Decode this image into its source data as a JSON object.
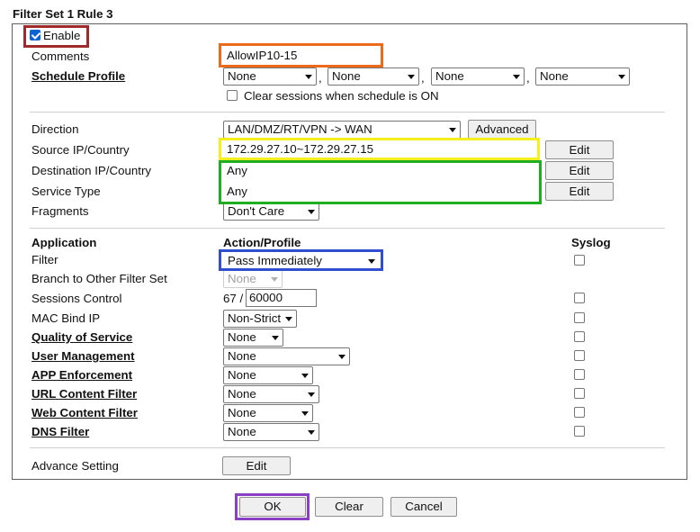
{
  "page_title": "Filter Set 1 Rule 3",
  "enable": {
    "label": "Enable",
    "checked": true
  },
  "comments": {
    "label": "Comments",
    "value": "AllowIP10-15"
  },
  "schedule": {
    "label": "Schedule Profile",
    "profiles": [
      "None",
      "None",
      "None",
      "None"
    ],
    "separator": ",",
    "clear_sessions_label": "Clear sessions when schedule is ON"
  },
  "direction": {
    "label": "Direction",
    "value": "LAN/DMZ/RT/VPN -> WAN",
    "advanced_label": "Advanced"
  },
  "source": {
    "label": "Source IP/Country",
    "value": "172.29.27.10~172.29.27.15",
    "edit_label": "Edit"
  },
  "destination": {
    "label": "Destination IP/Country",
    "value": "Any",
    "edit_label": "Edit"
  },
  "service": {
    "label": "Service Type",
    "value": "Any",
    "edit_label": "Edit"
  },
  "fragments": {
    "label": "Fragments",
    "value": "Don't Care"
  },
  "headers": {
    "application": "Application",
    "action": "Action/Profile",
    "syslog": "Syslog"
  },
  "filter": {
    "label": "Filter",
    "value": "Pass Immediately"
  },
  "branch": {
    "label": "Branch to Other Filter Set",
    "value": "None"
  },
  "sessions": {
    "label": "Sessions Control",
    "current": "67 /",
    "max": "60000"
  },
  "mac_bind": {
    "label": "MAC Bind IP",
    "value": "Non-Strict"
  },
  "qos": {
    "label": "Quality of Service",
    "value": "None"
  },
  "user_mgmt": {
    "label": "User Management",
    "value": "None"
  },
  "app_enf": {
    "label": "APP Enforcement",
    "value": "None"
  },
  "url_filter": {
    "label": "URL Content Filter",
    "value": "None"
  },
  "web_filter": {
    "label": "Web Content Filter",
    "value": "None"
  },
  "dns_filter": {
    "label": "DNS Filter",
    "value": "None"
  },
  "advance": {
    "label": "Advance Setting",
    "edit_label": "Edit"
  },
  "footer": {
    "ok": "OK",
    "clear": "Clear",
    "cancel": "Cancel"
  },
  "highlight_colors": {
    "enable": "#9e2a2b",
    "comments": "#ec6a1c",
    "source": "#f5ef1e",
    "dest_service": "#1fae1f",
    "filter": "#2f4fd0",
    "ok": "#8a3fc4"
  }
}
